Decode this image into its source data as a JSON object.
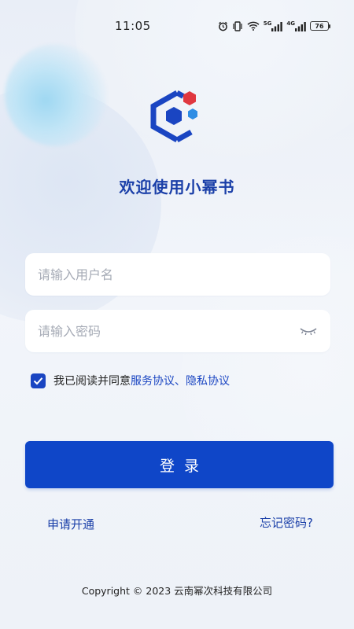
{
  "status_bar": {
    "time": "11:05",
    "battery": "76",
    "icons": [
      "alarm-icon",
      "vibrate-icon",
      "wifi-icon",
      "signal-5g-icon",
      "signal-4g-icon",
      "battery-icon"
    ],
    "net1": "5G",
    "net2": "4G"
  },
  "brand": {
    "title": "欢迎使用小幂书",
    "logo_colors": {
      "primary": "#1a45c2",
      "dot_red": "#e0373f",
      "dot_blue": "#2f8de4"
    }
  },
  "form": {
    "username_placeholder": "请输入用户名",
    "username_value": "",
    "password_placeholder": "请输入密码",
    "password_value": "",
    "password_toggle_icon": "eye-closed-icon",
    "agreement": {
      "checked": true,
      "prefix": "我已阅读并同意",
      "service_link": "服务协议",
      "separator": "、",
      "privacy_link": "隐私协议"
    },
    "login_label": "登录"
  },
  "links": {
    "apply": "申请开通",
    "forgot": "忘记密码?"
  },
  "footer": {
    "copyright": "Copyright © 2023 云南幂次科技有限公司"
  },
  "colors": {
    "accent": "#0f46c8",
    "title": "#1a3fa8",
    "background": "#eef2f8"
  }
}
